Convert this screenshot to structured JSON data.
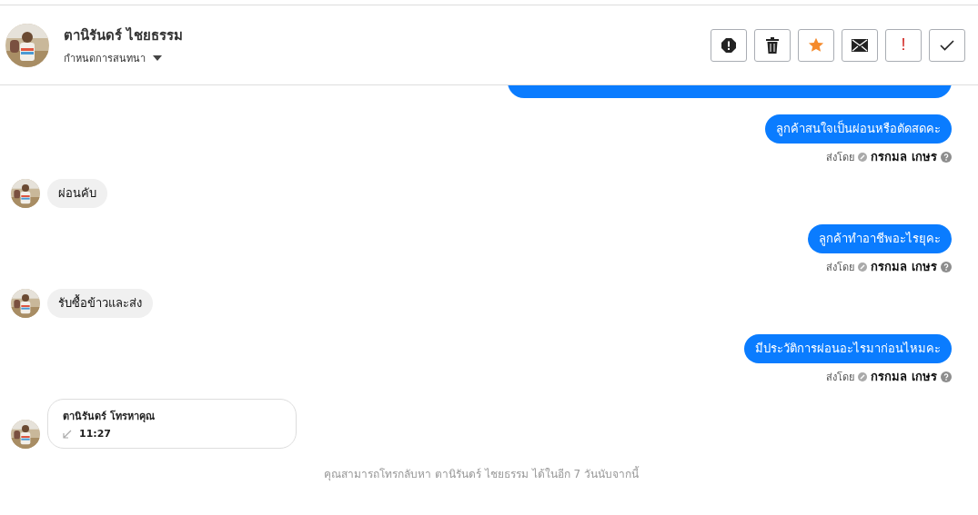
{
  "header": {
    "name": "ตานิรันดร์ ไชยธรรม",
    "subtitle": "กำหนดการสนทนา",
    "actions": [
      {
        "kind": "alert"
      },
      {
        "kind": "trash"
      },
      {
        "kind": "star"
      },
      {
        "kind": "mail"
      },
      {
        "kind": "exclaim",
        "text": "!"
      },
      {
        "kind": "check"
      }
    ]
  },
  "messages": [
    {
      "kind": "outgoing",
      "text": "ลูกค้าสนใจเป็นผ่อนหรือตัดสดคะ",
      "sent_by": "ส่งโดย",
      "sender": "กรกมล เกษร"
    },
    {
      "kind": "incoming",
      "text": "ผ่อนคับ"
    },
    {
      "kind": "outgoing",
      "text": "ลูกค้าทำอาชีพอะไรยุคะ",
      "sent_by": "ส่งโดย",
      "sender": "กรกมล เกษร"
    },
    {
      "kind": "incoming",
      "text": "รับซื้อข้าวและส่ง"
    },
    {
      "kind": "outgoing",
      "text": "มีประวัติการผ่อนอะไรมาก่อนไหมคะ",
      "sent_by": "ส่งโดย",
      "sender": "กรกมล เกษร"
    },
    {
      "kind": "call",
      "title": "ตานิรันดร์ โทรหาคุณ",
      "time": "11:27"
    }
  ],
  "footer": "คุณสามารถโทรกลับหา ตานิรันดร์ ไชยธรรม ได้ในอีก 7 วันนับจากนี้"
}
